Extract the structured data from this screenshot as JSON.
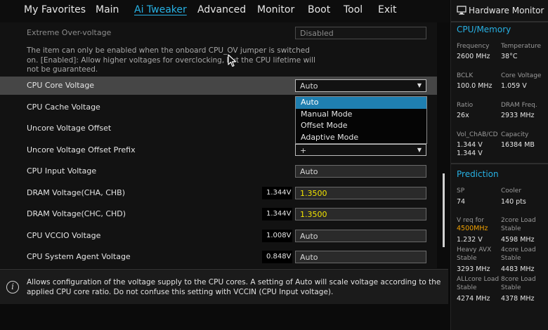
{
  "topnav": {
    "tabs": [
      "My Favorites",
      "Main",
      "Ai Tweaker",
      "Advanced",
      "Monitor",
      "Boot",
      "Tool",
      "Exit"
    ],
    "active_tab": "Ai Tweaker"
  },
  "settings": {
    "extreme_overvoltage": {
      "label": "Extreme Over-voltage",
      "value": "Disabled"
    },
    "note": "The item can only be enabled when the onboard CPU_OV jumper is switched on. [Enabled]: Allow higher voltages for overclocking, but the CPU lifetime will not be guaranteed.",
    "cpu_core_voltage": {
      "label": "CPU Core Voltage",
      "value": "Auto"
    },
    "cpu_cache_voltage": {
      "label": "CPU Cache Voltage"
    },
    "uncore_voltage_offset": {
      "label": "Uncore Voltage Offset"
    },
    "uncore_voltage_offset_prefix": {
      "label": "Uncore Voltage Offset Prefix",
      "value": "+"
    },
    "cpu_input_voltage": {
      "label": "CPU Input Voltage",
      "value": "Auto"
    },
    "dram_voltage_ab": {
      "label": "DRAM Voltage(CHA, CHB)",
      "reading": "1.344V",
      "value": "1.3500"
    },
    "dram_voltage_cd": {
      "label": "DRAM Voltage(CHC, CHD)",
      "reading": "1.344V",
      "value": "1.3500"
    },
    "cpu_vccio_voltage": {
      "label": "CPU VCCIO Voltage",
      "reading": "1.008V",
      "value": "Auto"
    },
    "cpu_sa_voltage": {
      "label": "CPU System Agent Voltage",
      "reading": "0.848V",
      "value": "Auto"
    }
  },
  "dropdown": {
    "options": [
      "Auto",
      "Manual Mode",
      "Offset Mode",
      "Adaptive Mode"
    ],
    "highlighted": "Auto"
  },
  "help": {
    "text": "Allows configuration of the voltage supply to the CPU cores. A setting of Auto will scale voltage according to the applied CPU core ratio.  Do not confuse this setting with VCCIN (CPU Input voltage)."
  },
  "monitor": {
    "title": "Hardware Monitor",
    "cpu_memory": {
      "heading": "CPU/Memory",
      "frequency": {
        "label": "Frequency",
        "value": "2600 MHz"
      },
      "temperature": {
        "label": "Temperature",
        "value": "38°C"
      },
      "bclk": {
        "label": "BCLK",
        "value": "100.0 MHz"
      },
      "core_voltage": {
        "label": "Core Voltage",
        "value": "1.059 V"
      },
      "ratio": {
        "label": "Ratio",
        "value": "26x"
      },
      "dram_freq": {
        "label": "DRAM Freq.",
        "value": "2933 MHz"
      },
      "vol_chab_cd": {
        "label": "Vol_ChAB/CD",
        "value1": "1.344 V",
        "value2": "1.344 V"
      },
      "capacity": {
        "label": "Capacity",
        "value": "16384 MB"
      }
    },
    "prediction": {
      "heading": "Prediction",
      "sp": {
        "label": "SP",
        "value": "74"
      },
      "cooler": {
        "label": "Cooler",
        "value": "140 pts"
      },
      "vreq": {
        "label": "V req for",
        "freq": "4500MHz",
        "value": "1.232 V"
      },
      "two_core": {
        "label1": "2core Load",
        "label2": "Stable",
        "value": "4598 MHz"
      },
      "heavy_avx": {
        "label1": "Heavy AVX",
        "label2": "Stable",
        "value": "3293 MHz"
      },
      "four_core": {
        "label1": "4core Load",
        "label2": "Stable",
        "value": "4483 MHz"
      },
      "all_core": {
        "label1": "ALLcore Load",
        "label2": "Stable",
        "value": "4274 MHz"
      },
      "eight_core": {
        "label1": "8core Load",
        "label2": "Stable",
        "value": "4378 MHz"
      }
    }
  },
  "colors": {
    "accent": "#27b1e4",
    "highlight": "#1f7fb0",
    "dram_value": "#f2e400",
    "freq_accent": "#f0a000"
  },
  "icons": [
    "info-icon",
    "monitor-icon",
    "dropdown-caret-icon",
    "mouse-cursor-icon"
  ]
}
